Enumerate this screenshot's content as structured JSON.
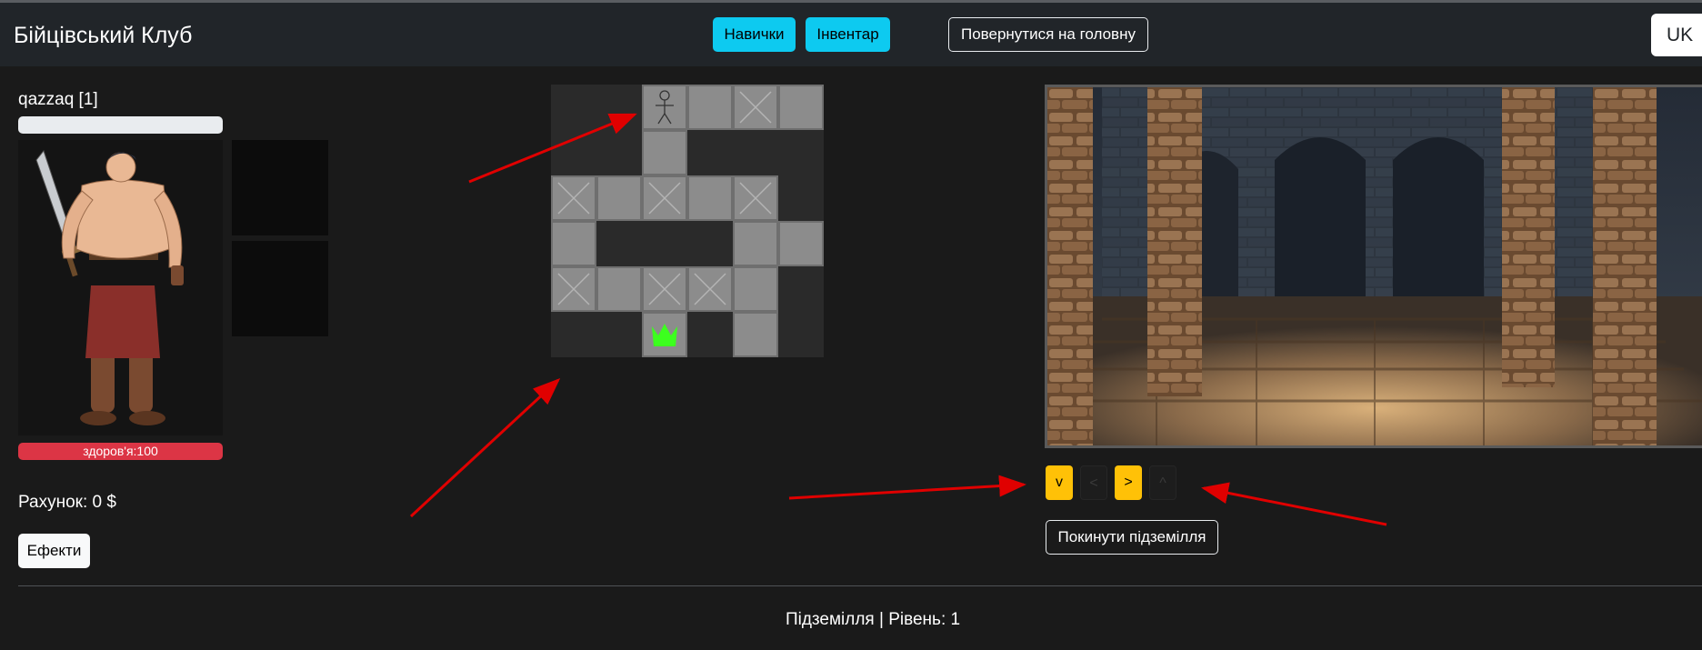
{
  "header": {
    "brand": "Бійцівський Клуб",
    "skills_label": "Навички",
    "inventory_label": "Інвентар",
    "home_label": "Повернутися на головну",
    "language": "UK"
  },
  "player": {
    "name_line": "qazzaq [1]",
    "health_label": "здоров'я:100",
    "balance_label": "Рахунок: 0 $",
    "effects_label": "Ефекти"
  },
  "map": {
    "grid_size": 6,
    "cells": [
      {
        "row": 0,
        "col": 2,
        "icon": "stick-figure-icon"
      },
      {
        "row": 0,
        "col": 3,
        "icon": ""
      },
      {
        "row": 0,
        "col": 4,
        "icon": "cross-icon"
      },
      {
        "row": 0,
        "col": 5,
        "icon": ""
      },
      {
        "row": 1,
        "col": 2,
        "icon": ""
      },
      {
        "row": 2,
        "col": 0,
        "icon": "cross-icon"
      },
      {
        "row": 2,
        "col": 1,
        "icon": ""
      },
      {
        "row": 2,
        "col": 2,
        "icon": "cross-icon"
      },
      {
        "row": 2,
        "col": 3,
        "icon": ""
      },
      {
        "row": 2,
        "col": 4,
        "icon": "cross-icon"
      },
      {
        "row": 3,
        "col": 0,
        "icon": ""
      },
      {
        "row": 3,
        "col": 4,
        "icon": ""
      },
      {
        "row": 3,
        "col": 5,
        "icon": ""
      },
      {
        "row": 4,
        "col": 0,
        "icon": "cross-icon"
      },
      {
        "row": 4,
        "col": 1,
        "icon": ""
      },
      {
        "row": 4,
        "col": 2,
        "icon": "cross-icon"
      },
      {
        "row": 4,
        "col": 3,
        "icon": "cross-icon"
      },
      {
        "row": 4,
        "col": 4,
        "icon": ""
      },
      {
        "row": 5,
        "col": 2,
        "icon": "crown-icon"
      },
      {
        "row": 5,
        "col": 4,
        "icon": ""
      }
    ]
  },
  "controls": {
    "down_label": "v",
    "left_label": "<",
    "right_label": ">",
    "up_label": "^",
    "leave_label": "Покинути підземілля"
  },
  "footer": {
    "text": "Підземілля | Рівень: 1"
  },
  "colors": {
    "info": "#0dcaf0",
    "warning": "#ffc107",
    "danger": "#dc3545",
    "annotation_arrow": "#e00000",
    "crown": "#3cff1e"
  }
}
